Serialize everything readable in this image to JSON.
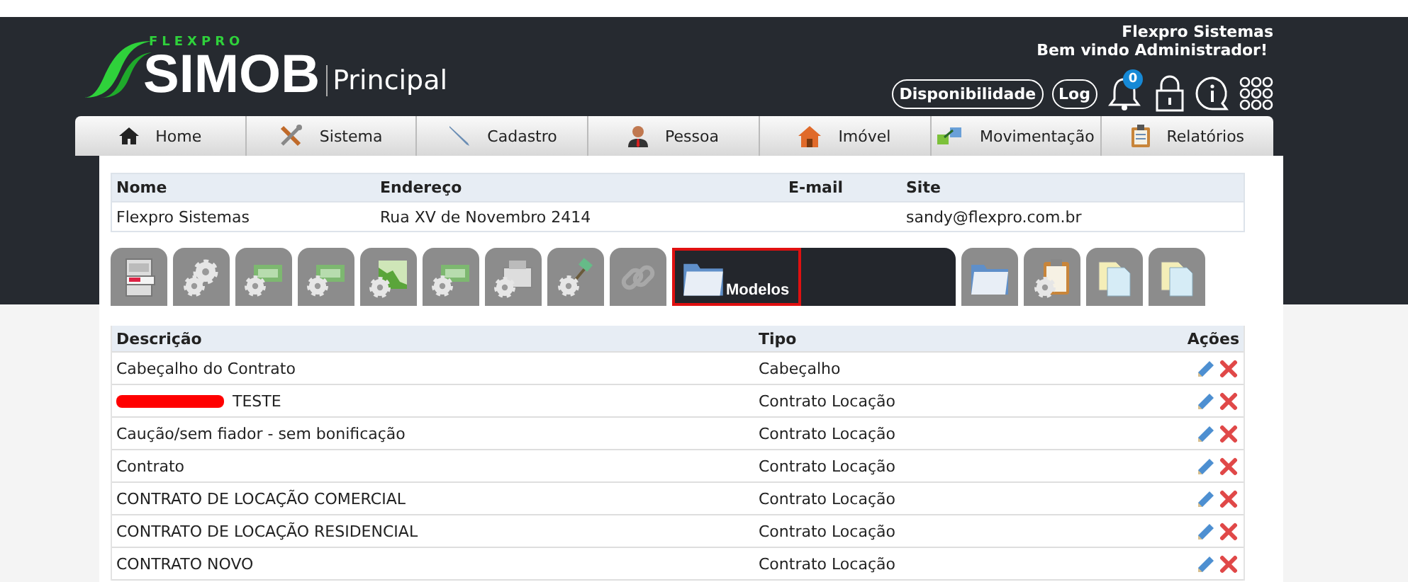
{
  "header": {
    "logo": {
      "brand": "FLEXPRO",
      "product": "SIMOB",
      "section": "Principal"
    },
    "company": "Flexpro Sistemas",
    "welcome": "Bem vindo Administrador!",
    "buttons": [
      "Disponibilidade",
      "Log"
    ],
    "notifications": "0"
  },
  "nav": [
    {
      "kind": "home",
      "label": "Home"
    },
    {
      "kind": "tools",
      "label": "Sistema"
    },
    {
      "kind": "pen",
      "label": "Cadastro"
    },
    {
      "kind": "person",
      "label": "Pessoa"
    },
    {
      "kind": "house",
      "label": "Imóvel"
    },
    {
      "kind": "transfer",
      "label": "Movimentação"
    },
    {
      "kind": "clipboard",
      "label": "Relatórios"
    }
  ],
  "company_table": {
    "columns": [
      "Nome",
      "Endereço",
      "E-mail",
      "Site"
    ],
    "row": {
      "name": "Flexpro Sistemas",
      "address": "Rua XV de Novembro 2414",
      "site": "sandy@flexpro.com.br"
    }
  },
  "tabs": [
    {
      "kind": "cabinet",
      "selected": false
    },
    {
      "kind": "gears",
      "selected": false
    },
    {
      "kind": "money",
      "selected": false
    },
    {
      "kind": "money",
      "selected": false
    },
    {
      "kind": "chart",
      "selected": false
    },
    {
      "kind": "money",
      "selected": false
    },
    {
      "kind": "register",
      "selected": false
    },
    {
      "kind": "gavel",
      "selected": false
    },
    {
      "kind": "link",
      "selected": false
    },
    {
      "kind": "folder",
      "label": "Modelos",
      "selected": true
    },
    {
      "kind": "folder",
      "selected": false
    },
    {
      "kind": "clipboard",
      "selected": false
    },
    {
      "kind": "documents",
      "selected": false
    },
    {
      "kind": "documents",
      "selected": false
    }
  ],
  "models_table": {
    "columns": [
      "Descrição",
      "Tipo",
      "Ações"
    ],
    "rows": [
      {
        "description": "Cabeçalho do Contrato",
        "type": "Cabeçalho",
        "redacted": false
      },
      {
        "description": "TESTE",
        "type": "Contrato Locação",
        "redacted": true
      },
      {
        "description": "Caução/sem fiador - sem bonificação",
        "type": "Contrato Locação",
        "redacted": false
      },
      {
        "description": "Contrato",
        "type": "Contrato Locação",
        "redacted": false
      },
      {
        "description": "CONTRATO DE LOCAÇÃO COMERCIAL",
        "type": "Contrato Locação",
        "redacted": false
      },
      {
        "description": "CONTRATO DE LOCAÇÃO RESIDENCIAL",
        "type": "Contrato Locação",
        "redacted": false
      },
      {
        "description": "CONTRATO NOVO",
        "type": "Contrato Locação",
        "redacted": false
      }
    ]
  }
}
